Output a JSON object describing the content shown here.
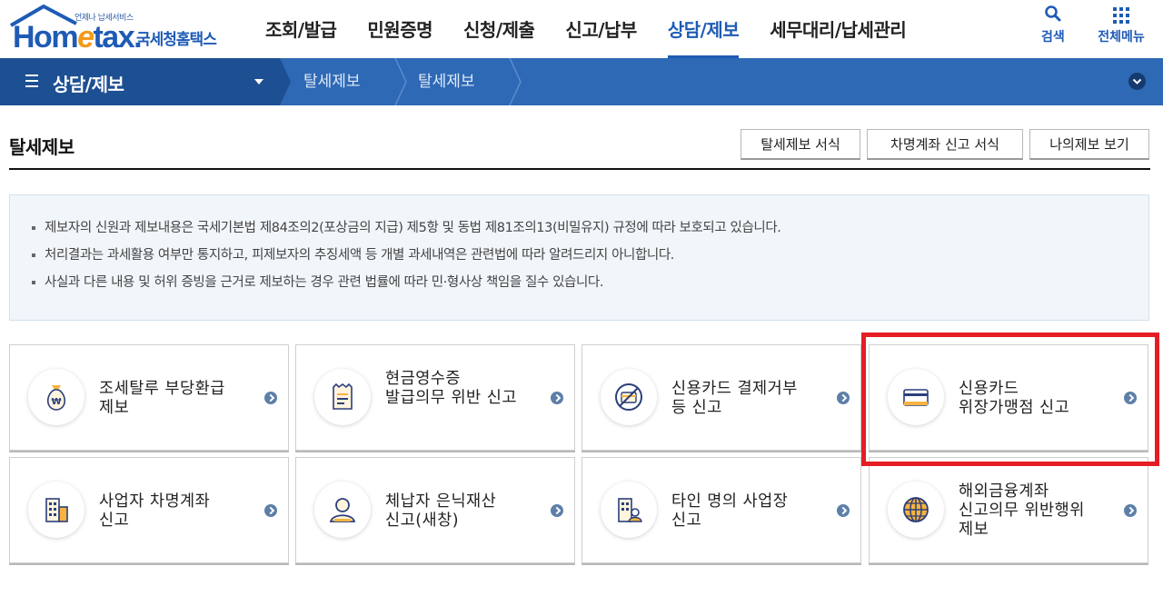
{
  "logo": {
    "tagline": "언제나 납세서비스",
    "word_main_a": "Hom",
    "word_main_e": "e",
    "word_main_b": "tax.",
    "korean_name": "국세청홈택스"
  },
  "gnb": {
    "items": [
      "조회/발급",
      "민원증명",
      "신청/제출",
      "신고/납부",
      "상담/제보",
      "세무대리/납세관리"
    ],
    "active_index": 4
  },
  "util": {
    "search_label": "검색",
    "menu_label": "전체메뉴"
  },
  "location": {
    "section_title": "상담/제보",
    "crumbs": [
      "탈세제보",
      "탈세제보"
    ]
  },
  "page": {
    "title": "탈세제보",
    "buttons": [
      "탈세제보 서식",
      "차명계좌 신고 서식",
      "나의제보 보기"
    ]
  },
  "notice": {
    "items": [
      "제보자의 신원과 제보내용은 국세기본법 제84조의2(포상금의 지급) 제5항 및 동법 제81조의13(비밀유지) 규정에 따라 보호되고 있습니다.",
      "처리결과는 과세활용 여부만 통지하고, 피제보자의 추징세액 등 개별 과세내역은 관련법에 따라 알려드리지 아니합니다.",
      "사실과 다른 내용 및 허위 증빙을 근거로 제보하는 경우 관련 법률에 따라 민·형사상 책임을 질수 있습니다."
    ]
  },
  "cards": [
    {
      "line1": "조세탈루 부당환급",
      "line2": "제보",
      "line3": "",
      "icon": "money-bag-icon"
    },
    {
      "line1": "현금영수증",
      "line2": "발급의무 위반 신고",
      "line3": "",
      "icon": "receipt-icon"
    },
    {
      "line1": "신용카드 결제거부",
      "line2": "등 신고",
      "line3": "",
      "icon": "card-refused-icon"
    },
    {
      "line1": "신용카드",
      "line2": "위장가맹점 신고",
      "line3": "",
      "icon": "credit-card-icon"
    },
    {
      "line1": "사업자 차명계좌",
      "line2": "신고",
      "line3": "",
      "icon": "building-icon"
    },
    {
      "line1": "체납자 은닉재산",
      "line2": "신고(새창)",
      "line3": "",
      "icon": "person-icon"
    },
    {
      "line1": "타인 명의 사업장",
      "line2": "신고",
      "line3": "",
      "icon": "building-person-icon"
    },
    {
      "line1": "해외금융계좌",
      "line2": "신고의무 위반행위",
      "line3": "제보",
      "icon": "globe-icon"
    }
  ],
  "colors": {
    "brand_blue": "#1e5bb5",
    "accent_orange": "#f29a1a",
    "highlight_red": "#e51d24"
  }
}
